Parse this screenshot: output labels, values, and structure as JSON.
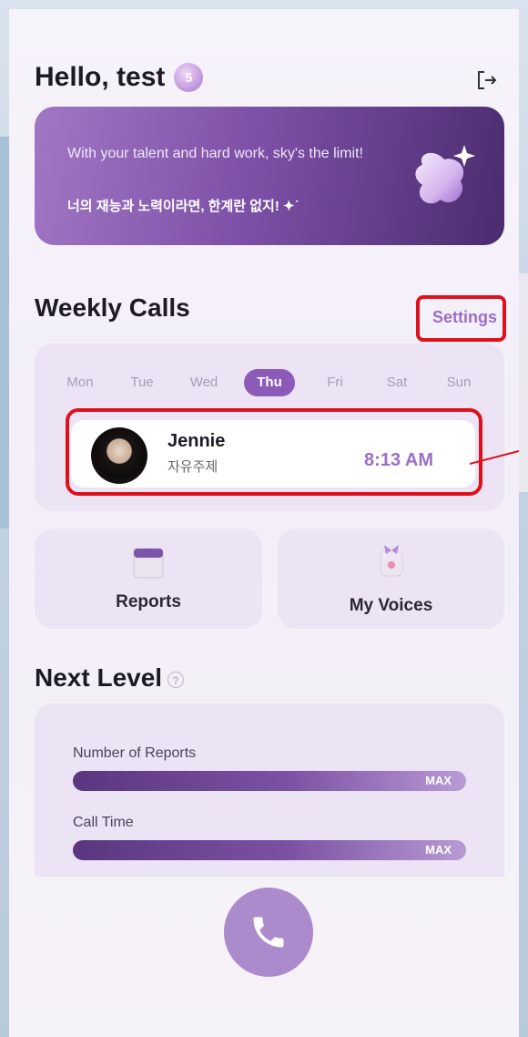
{
  "header": {
    "greeting": "Hello, test",
    "level_badge": "5"
  },
  "banner": {
    "text_en": "With your talent and hard work, sky's the limit!",
    "text_ko": "너의 재능과 노력이라면, 한계란 없지! ✦˙"
  },
  "weekly_calls": {
    "title": "Weekly Calls",
    "settings_label": "Settings",
    "days": [
      "Mon",
      "Tue",
      "Wed",
      "Thu",
      "Fri",
      "Sat",
      "Sun"
    ],
    "active_day": "Thu",
    "call": {
      "name": "Jennie",
      "topic": "자유주제",
      "time": "8:13 AM"
    }
  },
  "tiles": {
    "reports_label": "Reports",
    "voices_label": "My Voices"
  },
  "next_level": {
    "title": "Next Level",
    "items": [
      {
        "label": "Number of Reports",
        "value": "MAX",
        "progress": 1.0
      },
      {
        "label": "Call Time",
        "value": "MAX",
        "progress": 1.0
      }
    ]
  },
  "colors": {
    "accent": "#8c5bb9",
    "highlight": "#e0101a"
  },
  "icons": [
    "logout-icon",
    "blob-icon",
    "sparkle-icon",
    "reports-icon",
    "voices-icon",
    "help-icon",
    "phone-icon"
  ]
}
